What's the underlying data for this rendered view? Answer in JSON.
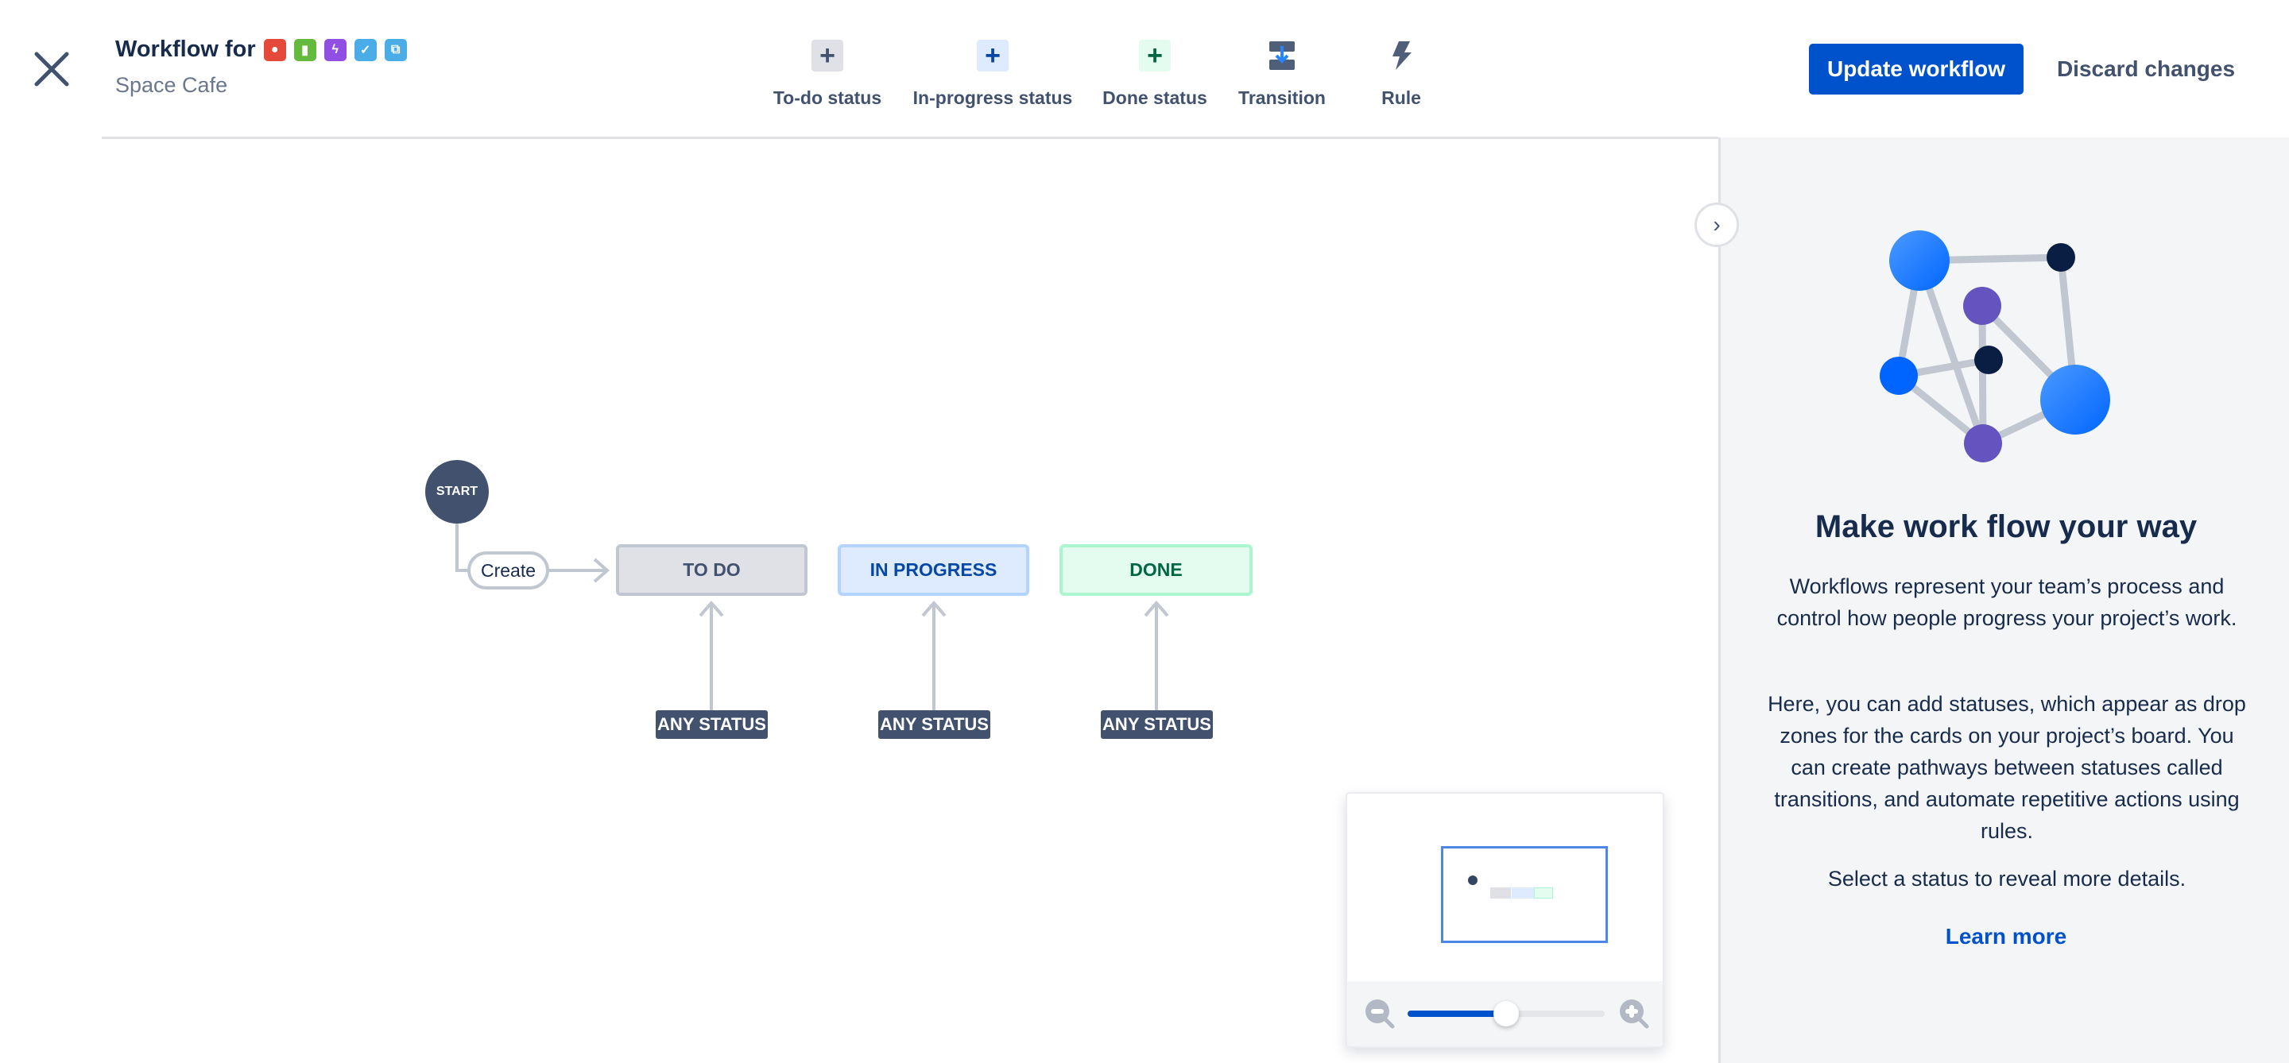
{
  "header": {
    "title": "Workflow for",
    "subtitle": "Space Cafe",
    "issue_type_icons": [
      {
        "name": "bug-icon",
        "color": "#e5493a",
        "glyph": "●"
      },
      {
        "name": "story-icon",
        "color": "#63ba3c",
        "glyph": "▮"
      },
      {
        "name": "epic-icon",
        "color": "#904ee2",
        "glyph": "ϟ"
      },
      {
        "name": "task-icon",
        "color": "#4bade8",
        "glyph": "✓"
      },
      {
        "name": "subtask-icon",
        "color": "#4bade8",
        "glyph": "⧉"
      }
    ],
    "update_label": "Update workflow",
    "discard_label": "Discard changes"
  },
  "toolbar": {
    "todo_label": "To-do status",
    "inprogress_label": "In-progress status",
    "done_label": "Done status",
    "transition_label": "Transition",
    "rule_label": "Rule"
  },
  "diagram": {
    "start": "START",
    "create": "Create",
    "statuses": [
      {
        "label": "TO DO",
        "bg": "#dfe1e6",
        "border": "#c1c7d0",
        "color": "#42526e"
      },
      {
        "label": "IN PROGRESS",
        "bg": "#deebff",
        "border": "#b3d4ff",
        "color": "#0747a6"
      },
      {
        "label": "DONE",
        "bg": "#e3fcef",
        "border": "#abf5d1",
        "color": "#006644"
      }
    ],
    "any_status": "ANY STATUS"
  },
  "minimap": {
    "zoom_percent": 50
  },
  "panel": {
    "title": "Make work flow your way",
    "p1": "Workflows represent your team’s process and control how people progress your project’s work.",
    "p2": "Here, you can add statuses, which appear as drop zones for the cards on your project’s board. You can create pathways between statuses called transitions, and automate repetitive actions using rules.",
    "p3": "Select a status to reveal more details.",
    "learn_more": "Learn more"
  },
  "colors": {
    "brand": "#0052cc",
    "text": "#172b4d",
    "subtle": "#42526e"
  }
}
